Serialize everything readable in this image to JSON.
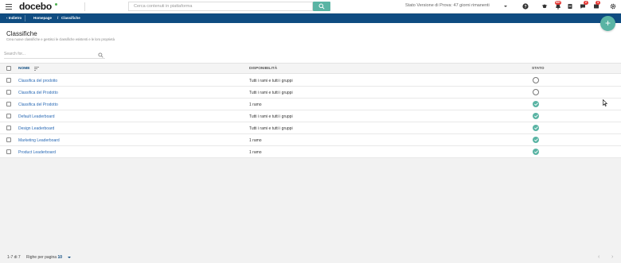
{
  "topbar": {
    "logo": "docebo",
    "search_placeholder": "Cerca contenuti in piattaforma",
    "plan_info": "Stato Versione di Prova: 47 giorni rimanenti",
    "badges": {
      "bell": "99+",
      "chat": "2",
      "notes": "3"
    }
  },
  "breadcrumb": {
    "back": "Indietro",
    "home": "Homepage",
    "separator": "/",
    "current": "Classifiche"
  },
  "header": {
    "title": "Classifiche",
    "subtitle": "Crea nuove classifiche e gestisci le classifiche esistenti e le loro proprietà",
    "add_symbol": "+"
  },
  "filter": {
    "placeholder": "Search for..."
  },
  "table": {
    "columns": {
      "name": "NOME",
      "availability": "DISPONIBILITÀ",
      "status": "STATO"
    },
    "rows": [
      {
        "name": "Classifica del prodotto",
        "availability": "Tutti i rami e tutti i gruppi",
        "active": false
      },
      {
        "name": "Classifica del Prodotto",
        "availability": "Tutti i rami e tutti i gruppi",
        "active": false
      },
      {
        "name": "Classifica del Prodotto",
        "availability": "1 ramo",
        "active": true
      },
      {
        "name": "Default Leaderboard",
        "availability": "Tutti i rami e tutti i gruppi",
        "active": true
      },
      {
        "name": "Design Leaderboard",
        "availability": "Tutti i rami e tutti i gruppi",
        "active": true
      },
      {
        "name": "Marketing Leaderboard",
        "availability": "1 ramo",
        "active": true
      },
      {
        "name": "Product Leaderboard",
        "availability": "1 ramo",
        "active": true
      }
    ]
  },
  "footer": {
    "count": "1-7 di 7",
    "rows_per_page_label": "Righe per pagina",
    "rows_per_page_value": "10",
    "prev": "‹",
    "next": "›"
  },
  "colors": {
    "brand": "#0f4c81",
    "accent": "#5ab4a4",
    "link": "#2a6ab5"
  }
}
